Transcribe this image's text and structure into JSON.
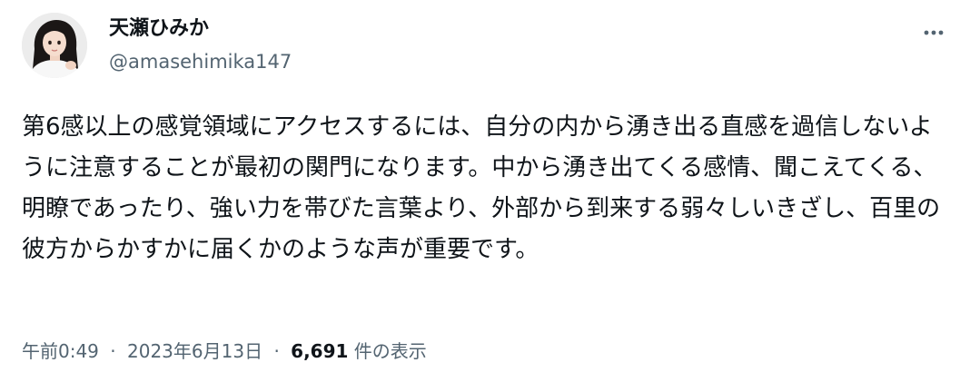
{
  "author": {
    "display_name": "天瀬ひみか",
    "handle": "@amasehimika147"
  },
  "icons": {
    "avatar": "profile-photo",
    "more": "more-horizontal-icon"
  },
  "tweet": {
    "text": "第6感以上の感覚領域にアクセスするには、自分の内から湧き出る直感を過信しないように注意することが最初の関門になります。中から湧き出てくる感情、聞こえてくる、明瞭であったり、強い力を帯びた言葉より、外部から到来する弱々しいきざし、百里の彼方からかすかに届くかのような声が重要です。"
  },
  "meta": {
    "time": "午前0:49",
    "separator": "·",
    "date": "2023年6月13日",
    "views_count": "6,691",
    "views_label": "件の表示"
  },
  "colors": {
    "text": "#0f1419",
    "secondary": "#536471",
    "background": "#ffffff"
  }
}
